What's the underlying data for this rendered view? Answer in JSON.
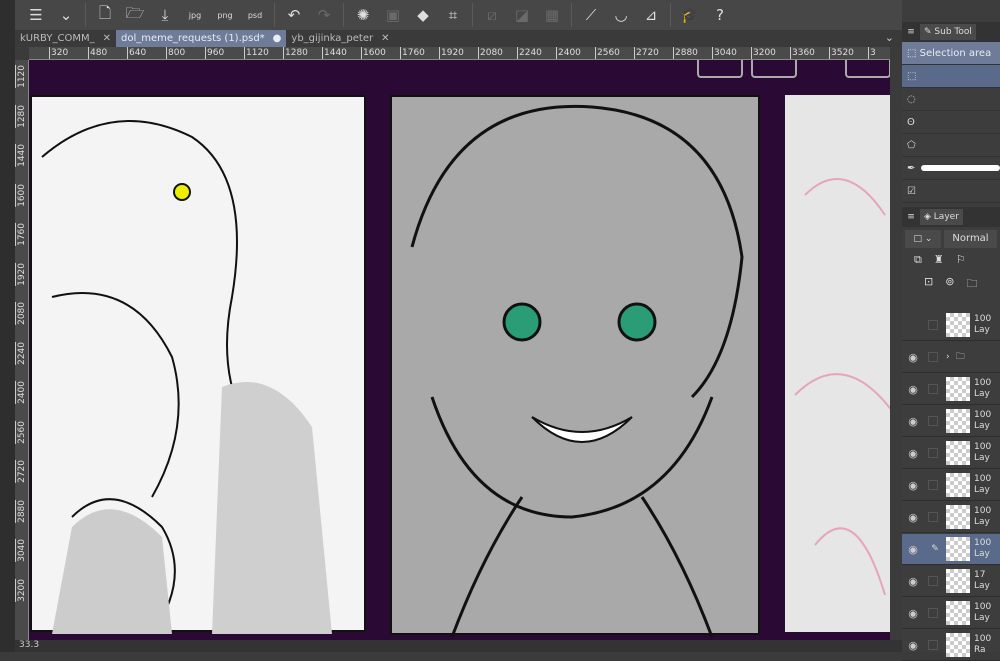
{
  "toolbar": {
    "icons": [
      "menu-icon",
      "chevron-down-icon",
      "new-file-icon",
      "open-folder-icon",
      "save-icon",
      "export-jpg-icon",
      "export-png-icon",
      "export-psd-icon",
      "undo-icon",
      "redo-icon",
      "loading-icon",
      "transform-icon",
      "fill-icon",
      "crop-icon",
      "clear-icon",
      "fill-selection-icon",
      "grid-icon",
      "ruler-icon",
      "brush-icon",
      "eraser-line-icon",
      "learn-icon",
      "help-icon"
    ],
    "jpg": "jpg",
    "png": "png",
    "psd": "psd"
  },
  "tabs": [
    {
      "label": "kURBY_COMM_"
    },
    {
      "label": "dol_meme_requests (1).psd*"
    },
    {
      "label": "yb_gijinka_peter"
    }
  ],
  "ruler_top": [
    "320",
    "480",
    "640",
    "800",
    "960",
    "1120",
    "1280",
    "1440",
    "1600",
    "1760",
    "1920",
    "2080",
    "2240",
    "2400",
    "2560",
    "2720",
    "2880",
    "3040",
    "3200",
    "3360",
    "3520",
    "3"
  ],
  "ruler_left": [
    "1120",
    "1280",
    "1440",
    "1600",
    "1760",
    "1920",
    "2080",
    "2240",
    "2400",
    "2560",
    "2720",
    "2880",
    "3040",
    "3200"
  ],
  "status": {
    "zoom": "33.3"
  },
  "subtool": {
    "tab": "Sub Tool",
    "group": "Selection area"
  },
  "layer": {
    "tab": "Layer",
    "blend": "Normal",
    "rows": [
      {
        "op": "100",
        "name": "Lay",
        "visible": false
      },
      {
        "op": "",
        "name": "",
        "folder": true,
        "visible": true
      },
      {
        "op": "100",
        "name": "Lay",
        "visible": true
      },
      {
        "op": "100",
        "name": "Lay",
        "visible": true
      },
      {
        "op": "100",
        "name": "Lay",
        "visible": true
      },
      {
        "op": "100",
        "name": "Lay",
        "visible": true
      },
      {
        "op": "100",
        "name": "Lay",
        "visible": true
      },
      {
        "op": "100",
        "name": "Lay",
        "visible": true,
        "selected": true
      },
      {
        "op": "17",
        "name": "Lay",
        "visible": true
      },
      {
        "op": "100",
        "name": "Lay",
        "visible": true
      },
      {
        "op": "100",
        "name": "Ra",
        "visible": true
      }
    ]
  },
  "colors": {
    "accent": "#6e7c99",
    "canvas_bg": "#2a0a35"
  }
}
